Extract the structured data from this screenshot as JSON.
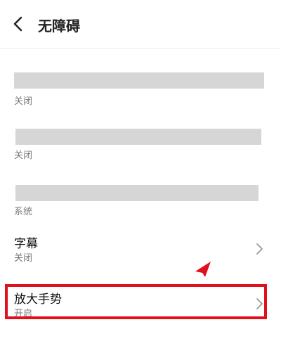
{
  "header": {
    "title": "无障碍",
    "back_icon": "chevron-left-icon"
  },
  "items": [
    {
      "status": "关闭",
      "title_redacted": true
    },
    {
      "status": "关闭",
      "title_redacted": true
    },
    {
      "status": "系统",
      "title_redacted": true
    },
    {
      "title": "字幕",
      "status": "关闭",
      "chevron": "chevron-right-icon"
    },
    {
      "title": "放大手势",
      "status": "开启",
      "chevron": "chevron-right-icon",
      "highlighted": true
    }
  ],
  "colors": {
    "highlight": "#e0101c",
    "redaction": "#d6d6d6"
  }
}
